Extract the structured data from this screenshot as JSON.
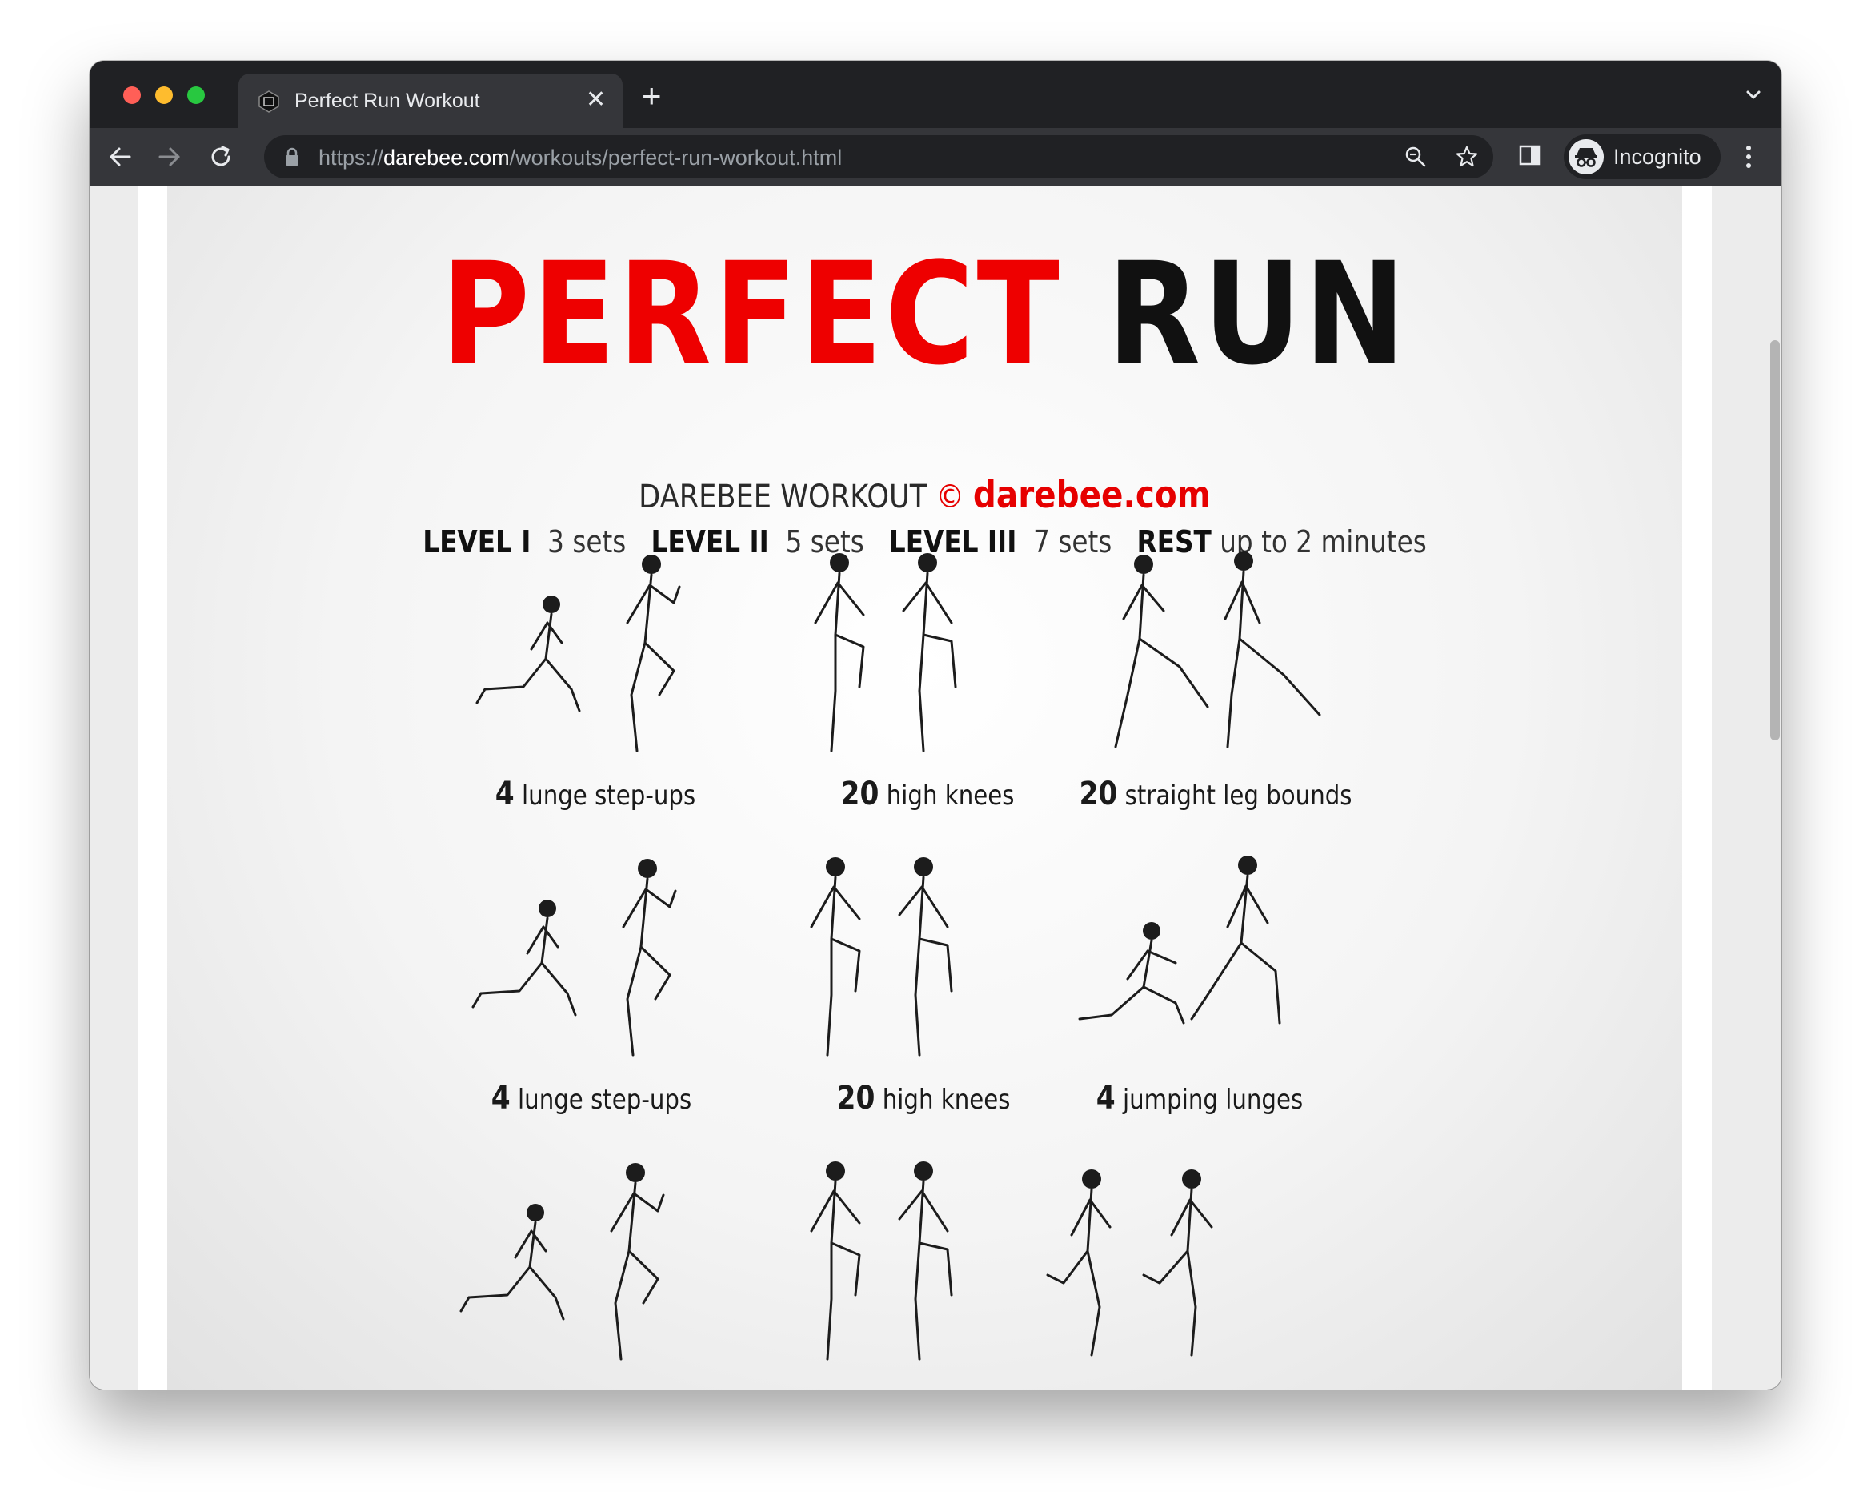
{
  "browser": {
    "tab_title": "Perfect Run Workout",
    "url_scheme": "https://",
    "url_host": "darebee.com",
    "url_path": "/workouts/perfect-run-workout.html",
    "profile_label": "Incognito"
  },
  "poster": {
    "title_red": "PERFECT",
    "title_black": "RUN",
    "brand_text": "DAREBEE WORKOUT",
    "copyright_symbol": "©",
    "brand_site": "darebee.com",
    "levels": [
      {
        "label": "LEVEL I",
        "value": "3 sets"
      },
      {
        "label": "LEVEL II",
        "value": "5 sets"
      },
      {
        "label": "LEVEL III",
        "value": "7 sets"
      },
      {
        "label": "REST",
        "value": "up to 2 minutes"
      }
    ],
    "exercises": [
      {
        "count": "4",
        "name": "lunge step-ups",
        "pose": "lunge"
      },
      {
        "count": "20",
        "name": "high knees",
        "pose": "knees"
      },
      {
        "count": "20",
        "name": "straight leg bounds",
        "pose": "bounds"
      },
      {
        "count": "4",
        "name": "lunge step-ups",
        "pose": "lunge"
      },
      {
        "count": "20",
        "name": "high knees",
        "pose": "knees"
      },
      {
        "count": "4",
        "name": "jumping lunges",
        "pose": "jumplunge"
      },
      {
        "count": "",
        "name": "",
        "pose": "lunge"
      },
      {
        "count": "",
        "name": "",
        "pose": "knees"
      },
      {
        "count": "",
        "name": "",
        "pose": "run"
      }
    ]
  },
  "colors": {
    "accent_red": "#ee0000",
    "chrome_dark": "#202124",
    "chrome_toolbar": "#35363a"
  },
  "icons": [
    "poster-site-favicon",
    "close-icon",
    "plus-icon",
    "chevron-down-icon",
    "back-arrow-icon",
    "forward-arrow-icon",
    "reload-icon",
    "lock-icon",
    "zoom-icon",
    "star-icon",
    "side-panel-icon",
    "incognito-icon",
    "more-vert-icon"
  ]
}
